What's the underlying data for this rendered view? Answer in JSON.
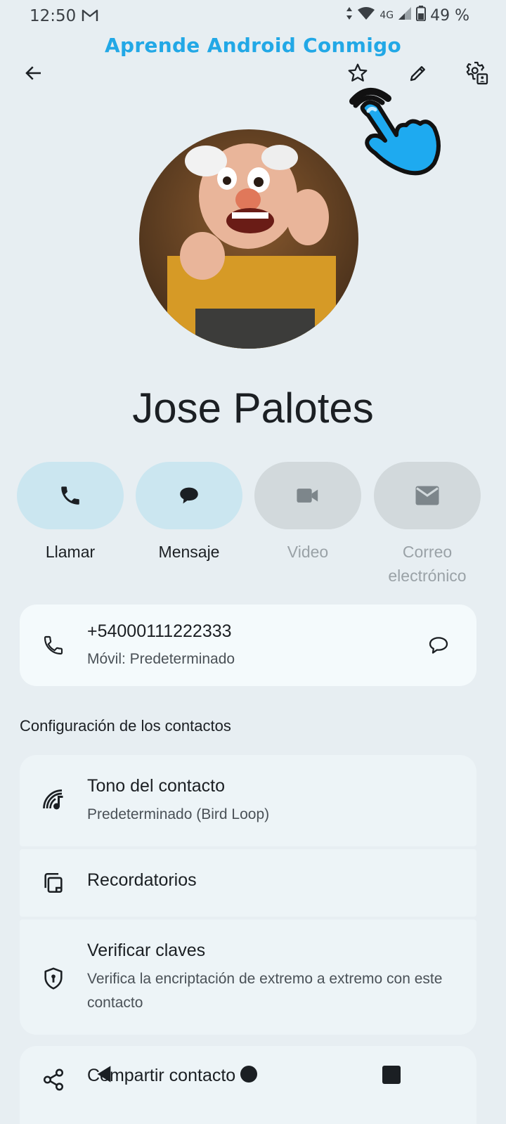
{
  "status_bar": {
    "time": "12:50",
    "network": "4G",
    "battery": "49 %"
  },
  "watermark": "Aprende Android Conmigo",
  "contact": {
    "name": "Jose Palotes"
  },
  "actions": [
    {
      "label": "Llamar",
      "enabled": true,
      "icon": "phone-icon"
    },
    {
      "label": "Mensaje",
      "enabled": true,
      "icon": "message-icon"
    },
    {
      "label": "Video",
      "enabled": false,
      "icon": "video-icon"
    },
    {
      "label": "Correo electrónico",
      "enabled": false,
      "icon": "mail-icon"
    }
  ],
  "phone": {
    "number": "+54000111222333",
    "type": "Móvil: Predeterminado"
  },
  "settings": {
    "section_title": "Configuración de los contactos",
    "ringtone_title": "Tono del contacto",
    "ringtone_value": "Predeterminado (Bird Loop)",
    "reminders_title": "Recordatorios",
    "verify_title": "Verificar claves",
    "verify_sub": "Verifica la encriptación de extremo a extremo con este contacto",
    "share_title": "Compartir contacto"
  },
  "colors": {
    "background": "#e7eef2",
    "active_button": "#cbe6f0",
    "inactive_button": "#d2d9dc",
    "card": "#f4fafc",
    "watermark": "#22a8e6"
  }
}
